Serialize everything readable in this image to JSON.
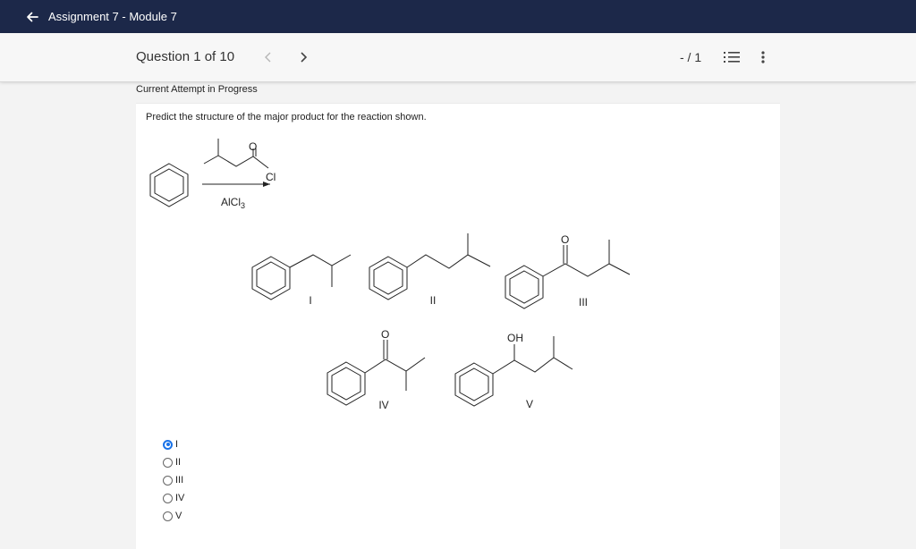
{
  "app": {
    "title": "Assignment 7 - Module 7"
  },
  "question_header": {
    "label": "Question 1 of 10",
    "score": "- / 1"
  },
  "attempt_status": "Current Attempt in Progress",
  "question": {
    "prompt": "Predict the structure of the major product for the reaction shown.",
    "reagent": "AlCl",
    "reagent_sub": "3",
    "acyl_cl": "Cl",
    "oxygen_label": "O",
    "oh_label": "OH",
    "structure_labels": [
      "I",
      "II",
      "III",
      "IV",
      "V"
    ]
  },
  "options": [
    {
      "label": "I",
      "selected": true
    },
    {
      "label": "II",
      "selected": false
    },
    {
      "label": "III",
      "selected": false
    },
    {
      "label": "IV",
      "selected": false
    },
    {
      "label": "V",
      "selected": false
    }
  ],
  "colors": {
    "topbar": "#1c2849",
    "accent": "#1a73e8"
  }
}
